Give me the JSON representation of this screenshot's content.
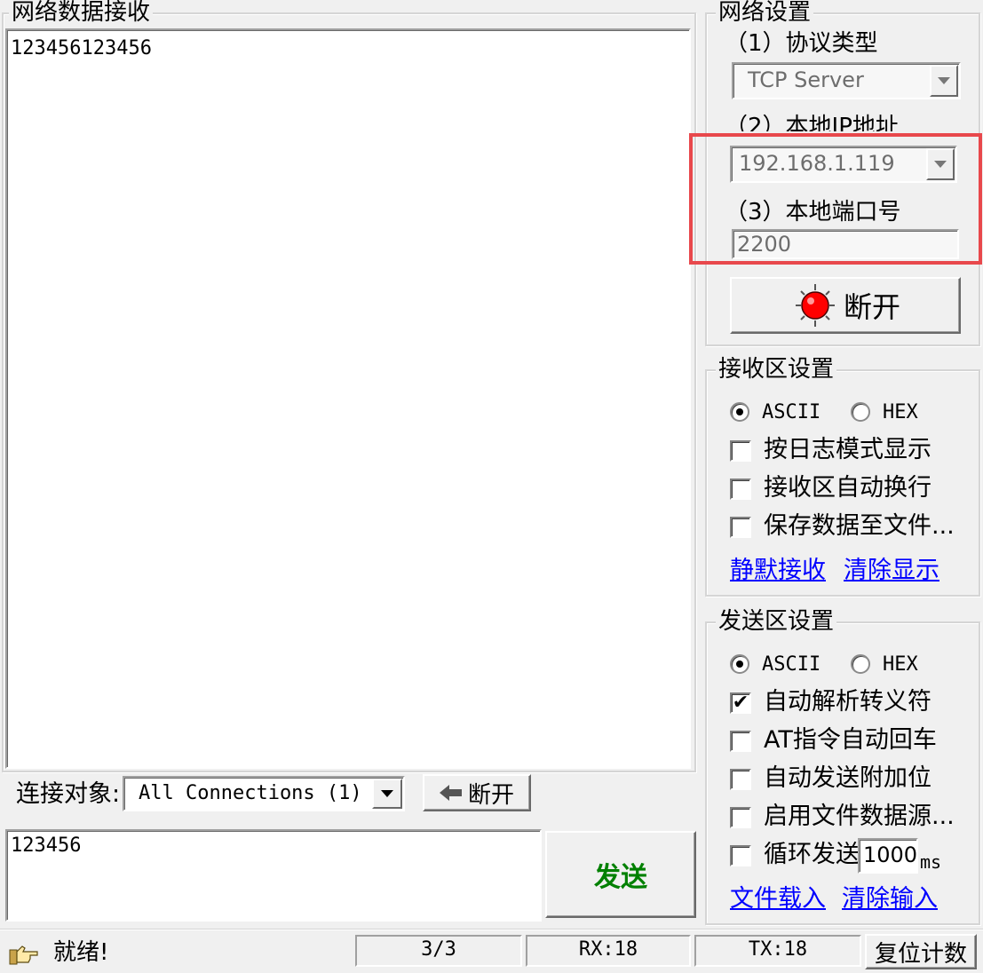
{
  "receive": {
    "title": "网络数据接收",
    "content": "123456123456"
  },
  "connection": {
    "label": "连接对象:",
    "selected": "All Connections (1)",
    "disconnect_label": "断开",
    "arrow_icon": "arrow-left-icon"
  },
  "send": {
    "input_value": "123456",
    "button_label": "发送",
    "button_color": "#008000"
  },
  "network_settings": {
    "title": "网络设置",
    "protocol_label": "（1）协议类型",
    "protocol_value": "TCP Server",
    "ip_label": "（2）本地IP地址",
    "ip_value": "192.168.1.119",
    "port_label": "（3）本地端口号",
    "port_value": "2200",
    "connect_button_label": "断开",
    "connect_icon": "red-led-icon",
    "highlight_color": "#e8484c"
  },
  "receive_settings": {
    "title": "接收区设置",
    "ascii_label": "ASCII",
    "hex_label": "HEX",
    "selected_mode": "ASCII",
    "options": [
      {
        "label": "按日志模式显示",
        "checked": false
      },
      {
        "label": "接收区自动换行",
        "checked": false
      },
      {
        "label": "保存数据至文件...",
        "checked": false
      }
    ],
    "link_pause": "静默接收",
    "link_clear": "清除显示"
  },
  "send_settings": {
    "title": "发送区设置",
    "ascii_label": "ASCII",
    "hex_label": "HEX",
    "selected_mode": "ASCII",
    "options": [
      {
        "label": "自动解析转义符",
        "checked": true
      },
      {
        "label": "AT指令自动回车",
        "checked": false
      },
      {
        "label": "自动发送附加位",
        "checked": false
      },
      {
        "label": "启用文件数据源...",
        "checked": false
      },
      {
        "label": "循环发送",
        "checked": false
      }
    ],
    "interval_value": "1000",
    "interval_unit": "ms",
    "check_mark": "✔",
    "link_load": "文件载入",
    "link_clear": "清除输入"
  },
  "status": {
    "icon": "pointing-hand-icon",
    "text": "就绪!",
    "counter": "3/3",
    "rx": "RX:18",
    "tx": "TX:18",
    "reset_label": "复位计数"
  }
}
